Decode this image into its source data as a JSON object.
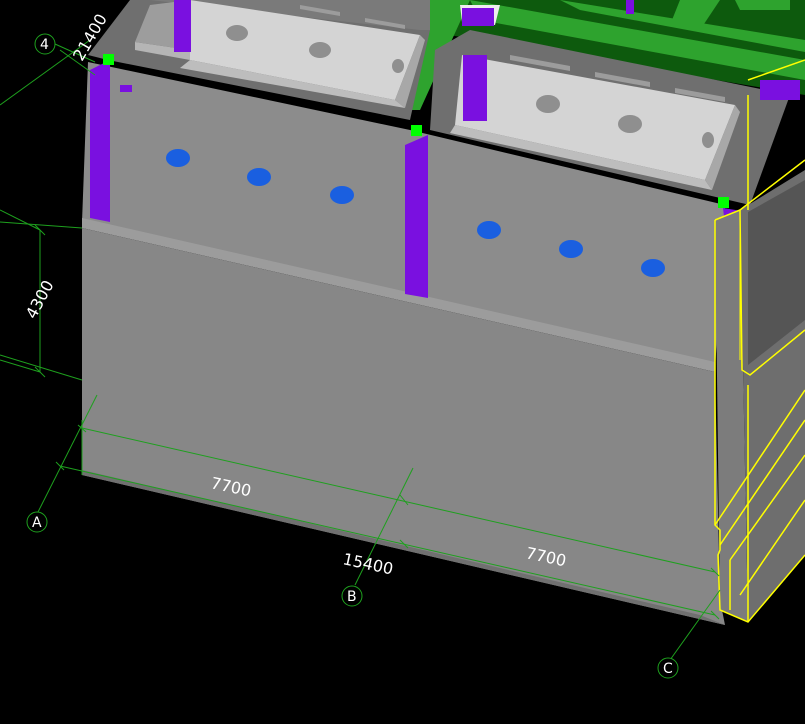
{
  "viewport": {
    "background": "#000000",
    "colors": {
      "wall_front": "#8a8a8a",
      "wall_top": "#9a9a9a",
      "wall_dark": "#6e6e6e",
      "inner_light": "#cfcfcf",
      "inner_mid": "#b9b9b9",
      "column_purple": "#7a10e0",
      "beam_green": "#2ea32e",
      "beam_dark_green": "#0d5a0d",
      "opening_blue": "#1a5fe0",
      "selection_yellow": "#ffff00",
      "grip_green": "#00ff00",
      "dimension_green": "#1ea01e"
    }
  },
  "dimensions": {
    "top_left": "21400",
    "height": "4300",
    "span_a_b": "7700",
    "span_b_c": "7700",
    "total": "15400"
  },
  "axes": {
    "axis_4": "4",
    "axis_a": "A",
    "axis_b": "B",
    "axis_c": "C"
  }
}
